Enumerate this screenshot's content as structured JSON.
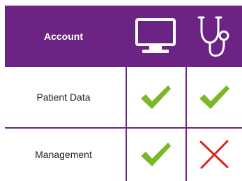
{
  "header": {
    "title": "Account",
    "columns": [
      {
        "icon": "monitor-icon"
      },
      {
        "icon": "stethoscope-icon"
      }
    ]
  },
  "rows": [
    {
      "label": "Patient Data",
      "values": [
        "check",
        "check"
      ]
    },
    {
      "label": "Management",
      "values": [
        "check",
        "cross"
      ]
    }
  ],
  "colors": {
    "header_bg": "#6c2484",
    "grid_line": "#6c2484",
    "check": "#7ab828",
    "cross": "#d9261c",
    "header_text": "#ffffff"
  }
}
